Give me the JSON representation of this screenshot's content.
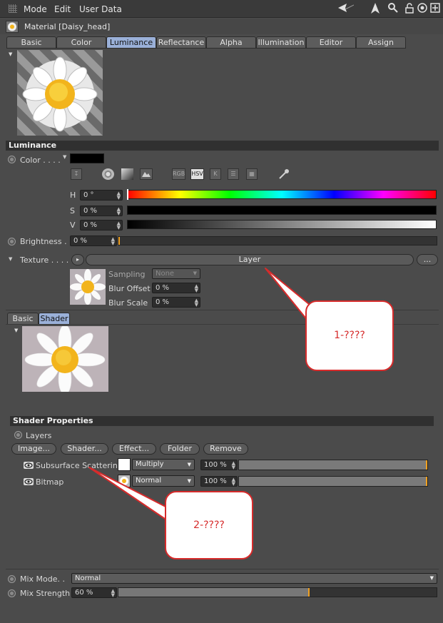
{
  "menu": {
    "mode": "Mode",
    "edit": "Edit",
    "user_data": "User Data"
  },
  "material": {
    "title": "Material [Daisy_head]"
  },
  "tabs": [
    {
      "label": "Basic"
    },
    {
      "label": "Color"
    },
    {
      "label": "Luminance"
    },
    {
      "label": "Reflectance"
    },
    {
      "label": "Alpha"
    },
    {
      "label": "Illumination"
    },
    {
      "label": "Editor"
    },
    {
      "label": "Assign"
    }
  ],
  "active_tab": "Luminance",
  "luminance": {
    "section_title": "Luminance",
    "color_label": "Color . . . .",
    "color_value": "#000000",
    "tool_icons": {
      "rgb": "RGB",
      "hsv": "HSV",
      "k": "K"
    },
    "h": {
      "label": "H",
      "value": "0 °"
    },
    "s": {
      "label": "S",
      "value": "0 %"
    },
    "v": {
      "label": "V",
      "value": "0 %"
    },
    "brightness": {
      "label": "Brightness . .",
      "value": "0 %",
      "fraction": 0
    },
    "texture": {
      "label": "Texture . . . . .",
      "layer_button": "Layer",
      "more_button": "..."
    },
    "sampling": {
      "label": "Sampling",
      "value": "None"
    },
    "blur_offset": {
      "label": "Blur Offset",
      "value": "0 %"
    },
    "blur_scale": {
      "label": "Blur Scale",
      "value": "0 %"
    }
  },
  "subtabs": [
    {
      "label": "Basic"
    },
    {
      "label": "Shader"
    }
  ],
  "shader_properties": {
    "section_title": "Shader Properties",
    "layers_label": "Layers",
    "buttons": {
      "image": "Image...",
      "shader": "Shader...",
      "effect": "Effect...",
      "folder": "Folder",
      "remove": "Remove"
    },
    "rows": [
      {
        "name": "Subsurface Scattering",
        "blend": "Multiply",
        "opacity": "100 %",
        "fraction": 1.0
      },
      {
        "name": "Bitmap",
        "blend": "Normal",
        "opacity": "100 %",
        "fraction": 1.0
      }
    ]
  },
  "mix": {
    "mode_label": "Mix Mode. .",
    "mode_value": "Normal",
    "strength_label": "Mix Strength",
    "strength_value": "60 %",
    "fraction": 0.6
  },
  "annotations": {
    "callout1": "1-????",
    "callout2": "2-????"
  },
  "colors": {
    "accent_tab": "#9ab0d8",
    "callout_red": "#d62b2b",
    "slider_marker": "#f0a020",
    "daisy_yellow": "#f2b41c"
  }
}
